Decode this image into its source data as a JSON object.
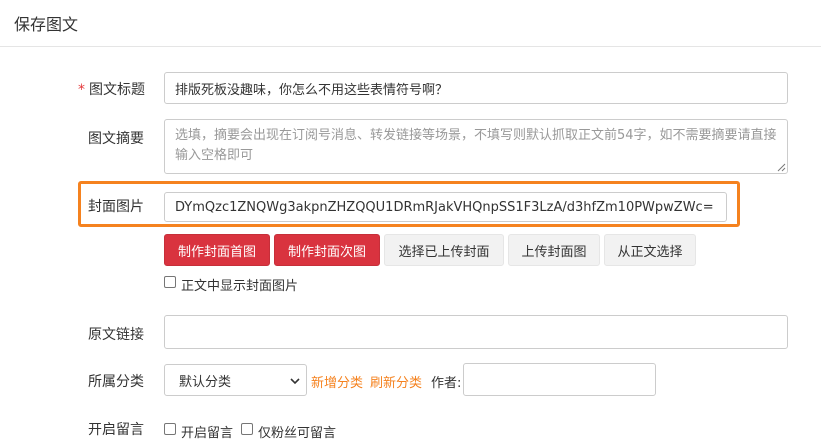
{
  "page": {
    "title": "保存图文"
  },
  "form": {
    "title": {
      "label": "图文标题",
      "required_mark": "*",
      "value": "排版死板没趣味，你怎么不用这些表情符号啊？"
    },
    "summary": {
      "label": "图文摘要",
      "placeholder": "选填，摘要会出现在订阅号消息、转发链接等场景，不填写则默认抓取正文前54字，如不需要摘要请直接输入空格即可"
    },
    "cover": {
      "label": "封面图片",
      "value": "DYmQzc1ZNQWg3akpnZHZQQU1DRmRJakVHQnpSS1F3LzA/d3hfZm10PWpwZWc=",
      "highlight_color": "#f5821f",
      "buttons": {
        "make_first": "制作封面首图",
        "make_second": "制作封面次图",
        "select_uploaded": "选择已上传封面",
        "upload": "上传封面图",
        "from_content": "从正文选择"
      },
      "show_in_content": {
        "label": "正文中显示封面图片",
        "checked": false
      }
    },
    "source_link": {
      "label": "原文链接",
      "value": ""
    },
    "category": {
      "label": "所属分类",
      "selected": "默认分类",
      "add_link": "新增分类",
      "refresh_link": "刷新分类",
      "author_label": "作者:",
      "author_value": ""
    },
    "comments": {
      "label": "开启留言",
      "enable": {
        "label": "开启留言",
        "checked": false
      },
      "fans_only": {
        "label": "仅粉丝可留言",
        "checked": false
      }
    }
  },
  "colors": {
    "accent_red": "#d9333f",
    "link_orange": "#f5821f"
  }
}
